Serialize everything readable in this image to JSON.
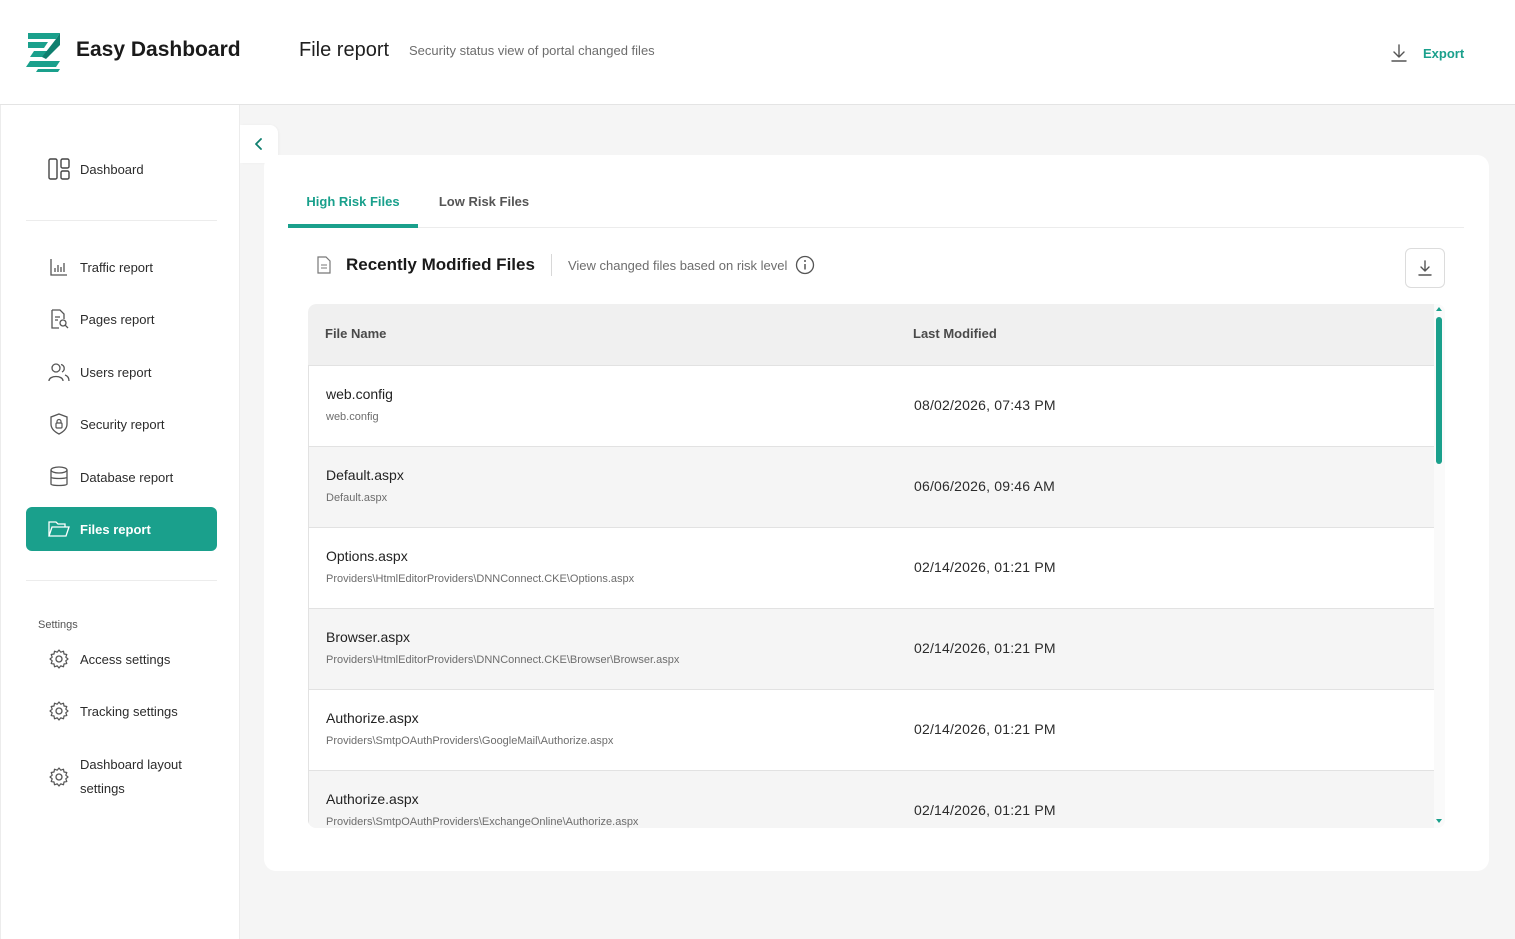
{
  "app": {
    "title": "Easy Dashboard"
  },
  "header": {
    "page_title": "File report",
    "page_subtitle": "Security status view of portal changed files",
    "export_label": "Export"
  },
  "sidebar": {
    "items": [
      {
        "label": "Dashboard",
        "icon": "dashboard-layout-icon"
      },
      {
        "label": "Traffic report",
        "icon": "bar-chart-icon"
      },
      {
        "label": "Pages report",
        "icon": "page-search-icon"
      },
      {
        "label": "Users report",
        "icon": "users-icon"
      },
      {
        "label": "Security report",
        "icon": "shield-lock-icon"
      },
      {
        "label": "Database report",
        "icon": "database-icon"
      },
      {
        "label": "Files report",
        "icon": "folder-open-icon",
        "active": true
      }
    ],
    "settings_label": "Settings",
    "settings_items": [
      {
        "label": "Access settings",
        "icon": "gear-icon"
      },
      {
        "label": "Tracking settings",
        "icon": "gear-icon"
      },
      {
        "label": "Dashboard layout settings",
        "icon": "gear-icon"
      }
    ]
  },
  "tabs": [
    {
      "label": "High Risk Files",
      "active": true
    },
    {
      "label": "Low Risk Files",
      "active": false
    }
  ],
  "section": {
    "title": "Recently Modified Files",
    "description": "View changed files based on risk level"
  },
  "table": {
    "columns": [
      "File Name",
      "Last Modified"
    ],
    "rows": [
      {
        "name": "web.config",
        "path": "web.config",
        "modified": "08/02/2026, 07:43 PM"
      },
      {
        "name": "Default.aspx",
        "path": "Default.aspx",
        "modified": "06/06/2026, 09:46 AM"
      },
      {
        "name": "Options.aspx",
        "path": "Providers\\HtmlEditorProviders\\DNNConnect.CKE\\Options.aspx",
        "modified": "02/14/2026, 01:21 PM"
      },
      {
        "name": "Browser.aspx",
        "path": "Providers\\HtmlEditorProviders\\DNNConnect.CKE\\Browser\\Browser.aspx",
        "modified": "02/14/2026, 01:21 PM"
      },
      {
        "name": "Authorize.aspx",
        "path": "Providers\\SmtpOAuthProviders\\GoogleMail\\Authorize.aspx",
        "modified": "02/14/2026, 01:21 PM"
      },
      {
        "name": "Authorize.aspx",
        "path": "Providers\\SmtpOAuthProviders\\ExchangeOnline\\Authorize.aspx",
        "modified": "02/14/2026, 01:21 PM"
      }
    ]
  },
  "colors": {
    "accent": "#1aa08c",
    "background": "#f5f5f5"
  }
}
